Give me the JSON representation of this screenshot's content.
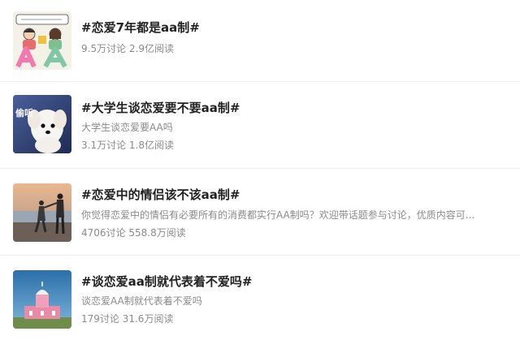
{
  "topics": [
    {
      "title": "#恋爱7年都是aa制#",
      "desc": "",
      "stats": "9.5万讨论 2.9亿阅读",
      "thumb_text": "AA"
    },
    {
      "title": "#大学生谈恋爱要不要aa制#",
      "desc": "大学生谈恋爱要AA吗",
      "stats": "3.1万讨论 1.8亿阅读",
      "thumb_text": "偷听"
    },
    {
      "title": "#恋爱中的情侣该不该aa制#",
      "desc": "你觉得恋爱中的情侣有必要所有的消费都实行AA制吗？欢迎带话题参与讨论，优质内容可...",
      "stats": "4706讨论 558.8万阅读",
      "thumb_text": ""
    },
    {
      "title": "#谈恋爱aa制就代表着不爱吗#",
      "desc": "谈恋爱AA制就代表着不爱吗",
      "stats": "179讨论 31.6万阅读",
      "thumb_text": ""
    }
  ],
  "colors": {
    "title": "#222222",
    "meta": "#8a8a8a",
    "divider": "#f0f0f0"
  }
}
